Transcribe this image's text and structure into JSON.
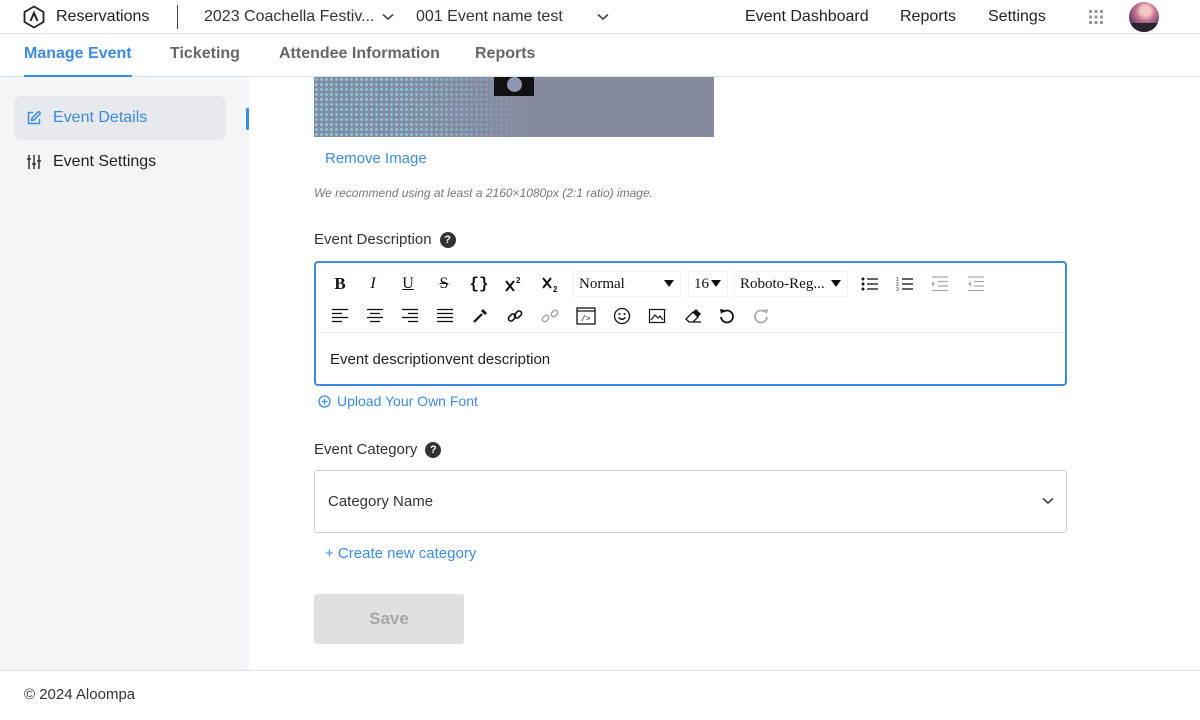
{
  "header": {
    "app_name": "Reservations",
    "event_select": "2023 Coachella Festiv...",
    "sub_event_select": "001 Event name test",
    "nav": [
      "Event Dashboard",
      "Reports",
      "Settings"
    ]
  },
  "tabs": [
    "Manage Event",
    "Ticketing",
    "Attendee Information",
    "Reports"
  ],
  "sidebar": {
    "items": [
      {
        "label": "Event Details",
        "icon": "edit-icon"
      },
      {
        "label": "Event Settings",
        "icon": "sliders-icon"
      }
    ]
  },
  "image": {
    "remove_label": "Remove Image",
    "hint": "We recommend using at least a 2160×1080px (2:1 ratio) image."
  },
  "description": {
    "label": "Event Description",
    "help_glyph": "?",
    "toolbar": {
      "format": "Normal",
      "font_size": "16",
      "font_family": "Roboto-Reg..."
    },
    "content": "Event descriptionvent description",
    "upload_font_label": "Upload Your Own Font"
  },
  "category": {
    "label": "Event Category",
    "help_glyph": "?",
    "placeholder": "Category Name",
    "create_label": "+ Create new category"
  },
  "save_label": "Save",
  "footer": "© 2024 Aloompa",
  "colors": {
    "accent": "#3c8be0",
    "sidebar_bg": "#f3f5f8",
    "save_disabled_bg": "#e0e0e0"
  }
}
